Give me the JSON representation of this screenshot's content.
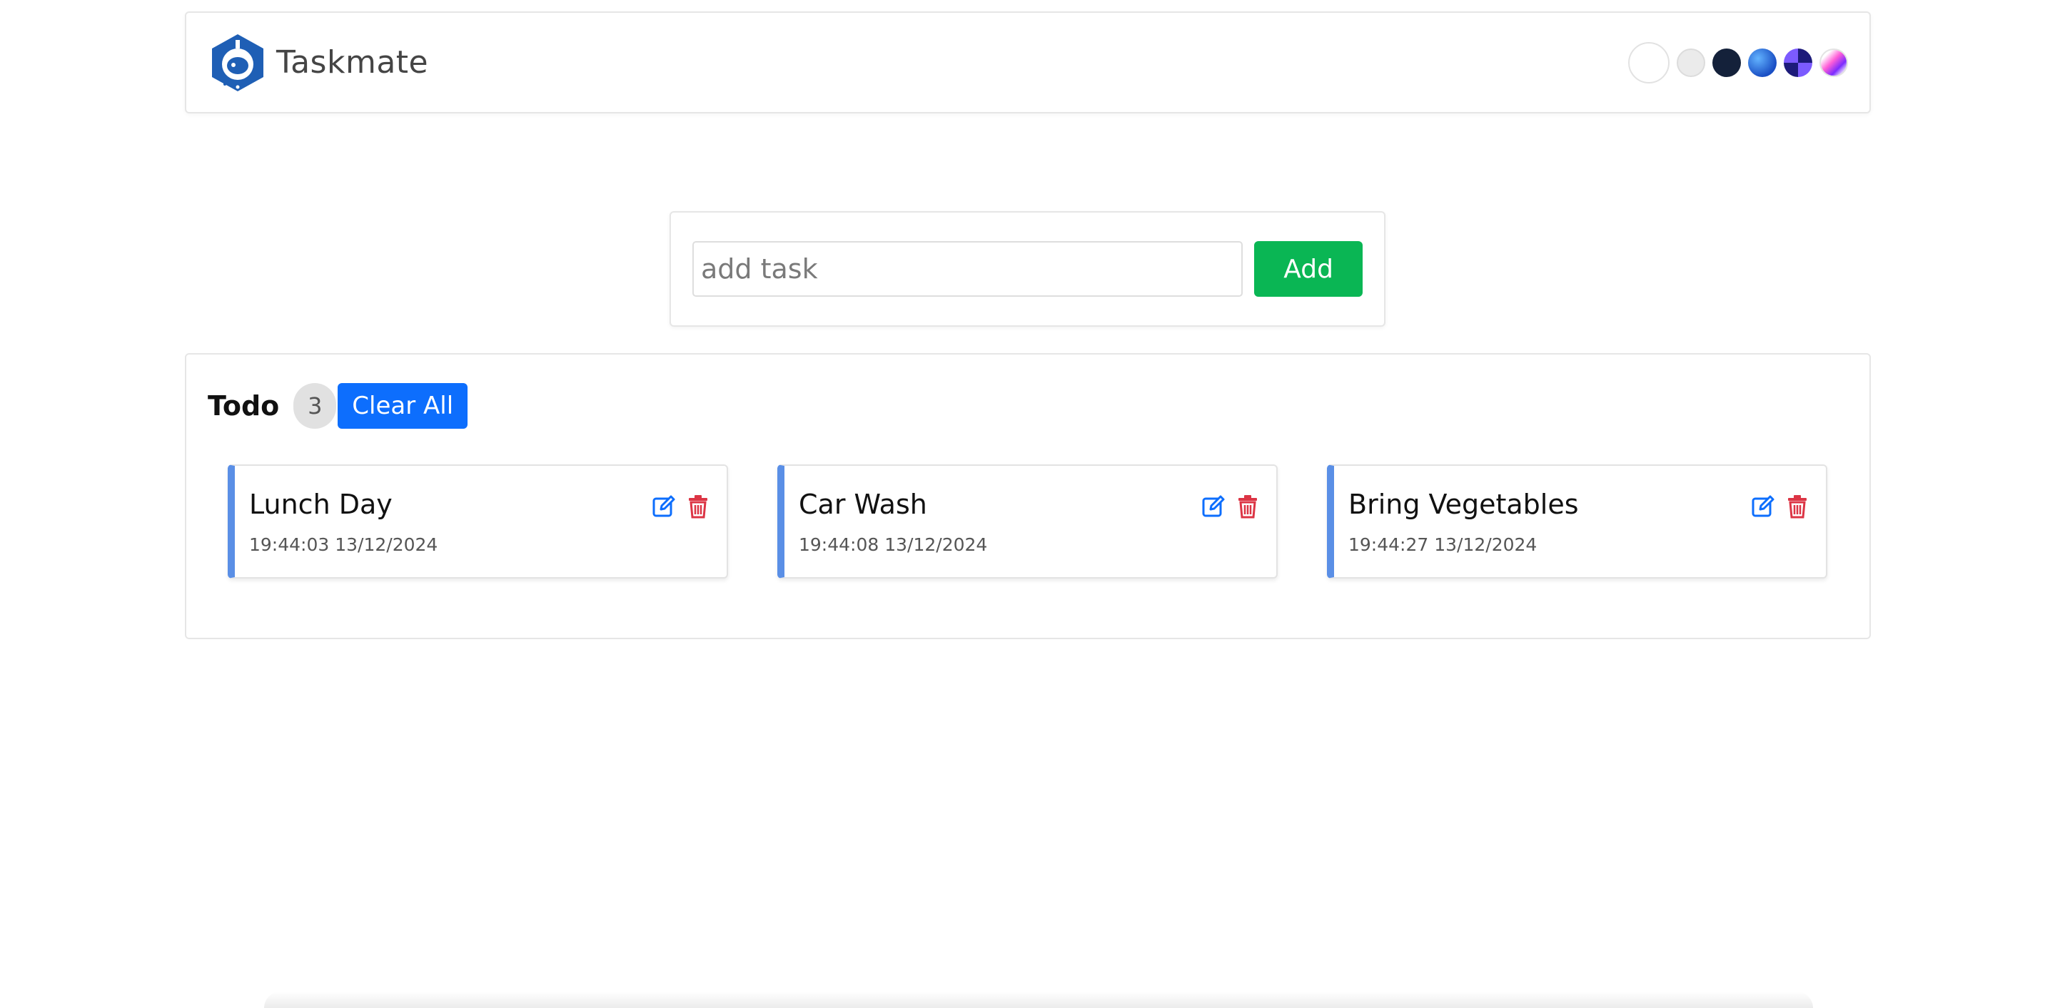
{
  "header": {
    "brand": "Taskmate",
    "logo_icon": "robot-logo-icon",
    "themes": [
      {
        "name": "default",
        "color": "#ffffff"
      },
      {
        "name": "light",
        "color": "#ebebeb"
      },
      {
        "name": "dark",
        "color": "#14213a"
      },
      {
        "name": "blue",
        "color": "#1a4fc4"
      },
      {
        "name": "gradient-one",
        "color": "#1d1b7a"
      },
      {
        "name": "gradient-two",
        "color": "#ff5ed7"
      }
    ]
  },
  "add_task": {
    "placeholder": "add task",
    "value": "",
    "button_label": "Add",
    "button_color": "#0ab654"
  },
  "todo": {
    "title": "Todo",
    "count": "3",
    "clear_label": "Clear All",
    "clear_color": "#0d6efd",
    "accent": "#5a8fe6",
    "tasks": [
      {
        "name": "Lunch Day",
        "time": "19:44:03 13/12/2024",
        "edit_icon": "edit-icon",
        "delete_icon": "trash-icon"
      },
      {
        "name": "Car Wash",
        "time": "19:44:08 13/12/2024",
        "edit_icon": "edit-icon",
        "delete_icon": "trash-icon"
      },
      {
        "name": "Bring Vegetables",
        "time": "19:44:27 13/12/2024",
        "edit_icon": "edit-icon",
        "delete_icon": "trash-icon"
      }
    ]
  }
}
